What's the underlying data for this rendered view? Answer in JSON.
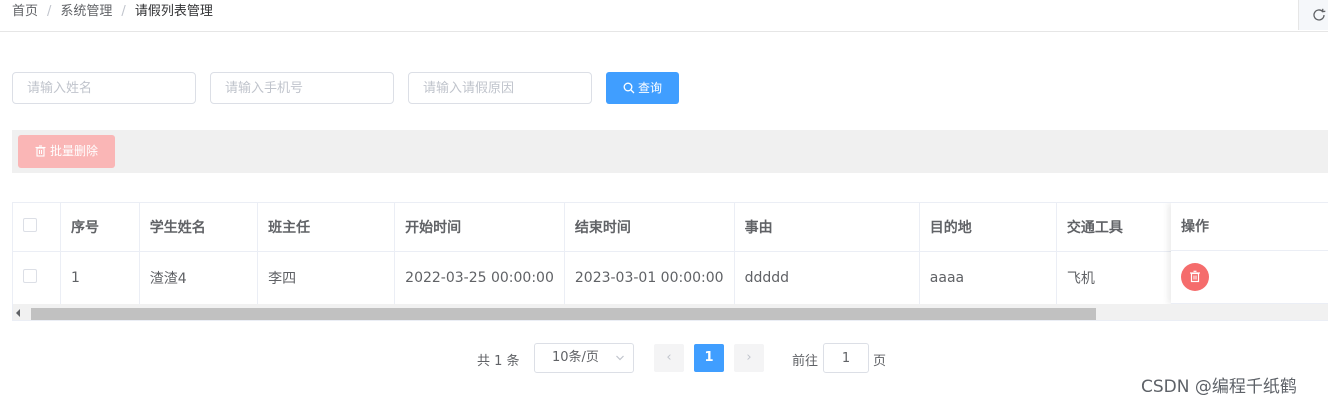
{
  "breadcrumb": {
    "items": [
      "首页",
      "系统管理",
      "请假列表管理"
    ],
    "separator": "/"
  },
  "search": {
    "name_placeholder": "请输入姓名",
    "phone_placeholder": "请输入手机号",
    "reason_placeholder": "请输入请假原因",
    "query_label": "查询"
  },
  "toolbar": {
    "batch_delete_label": "批量删除"
  },
  "table": {
    "columns": [
      "序号",
      "学生姓名",
      "班主任",
      "开始时间",
      "结束时间",
      "事由",
      "目的地",
      "交通工具",
      "操作"
    ],
    "rows": [
      {
        "index": "1",
        "student_name": "渣渣4",
        "head_teacher": "李四",
        "start_time": "2022-03-25 00:00:00",
        "end_time": "2023-03-01 00:00:00",
        "reason": "ddddd",
        "destination": "aaaa",
        "transport": "飞机"
      }
    ]
  },
  "pagination": {
    "total_text": "共 1 条",
    "page_size": "10条/页",
    "prev": "‹",
    "current_page": "1",
    "next": "›",
    "goto_label": "前往",
    "goto_value": "1",
    "goto_suffix": "页"
  },
  "watermark": "CSDN @编程千纸鹤",
  "colors": {
    "primary": "#409eff",
    "danger": "#f56c6c",
    "danger_disabled": "#fab6b6"
  },
  "icons": {
    "refresh": "refresh-icon",
    "search": "search-icon",
    "delete": "trash-icon",
    "chevron": "chevron-down-icon"
  }
}
